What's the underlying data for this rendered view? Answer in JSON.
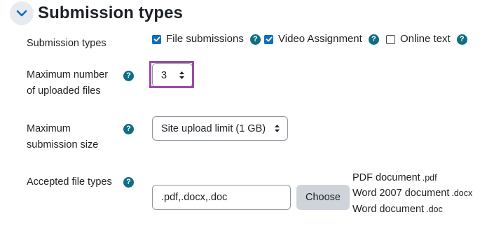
{
  "section": {
    "title": "Submission types"
  },
  "submission_types": {
    "label": "Submission types",
    "options": [
      {
        "label": "File submissions",
        "checked": true
      },
      {
        "label": "Video Assignment",
        "checked": true
      },
      {
        "label": "Online text",
        "checked": false
      }
    ]
  },
  "max_files": {
    "label_line1": "Maximum number",
    "label_line2": "of uploaded files",
    "value": "3"
  },
  "max_size": {
    "label_line1": "Maximum",
    "label_line2": "submission size",
    "value": "Site upload limit (1 GB)"
  },
  "accepted_types": {
    "label": "Accepted file types",
    "input_value": ".pdf,.docx,.doc",
    "choose_label": "Choose",
    "types": [
      {
        "name": "PDF document",
        "ext": ".pdf"
      },
      {
        "name": "Word 2007 document",
        "ext": ".docx"
      },
      {
        "name": "Word document",
        "ext": ".doc"
      }
    ]
  },
  "help_icon_glyph": "?",
  "colors": {
    "help": "#0f6e84",
    "checkbox": "#0f6cbf",
    "highlight": "#9c4aa6",
    "button": "#ced4da"
  }
}
